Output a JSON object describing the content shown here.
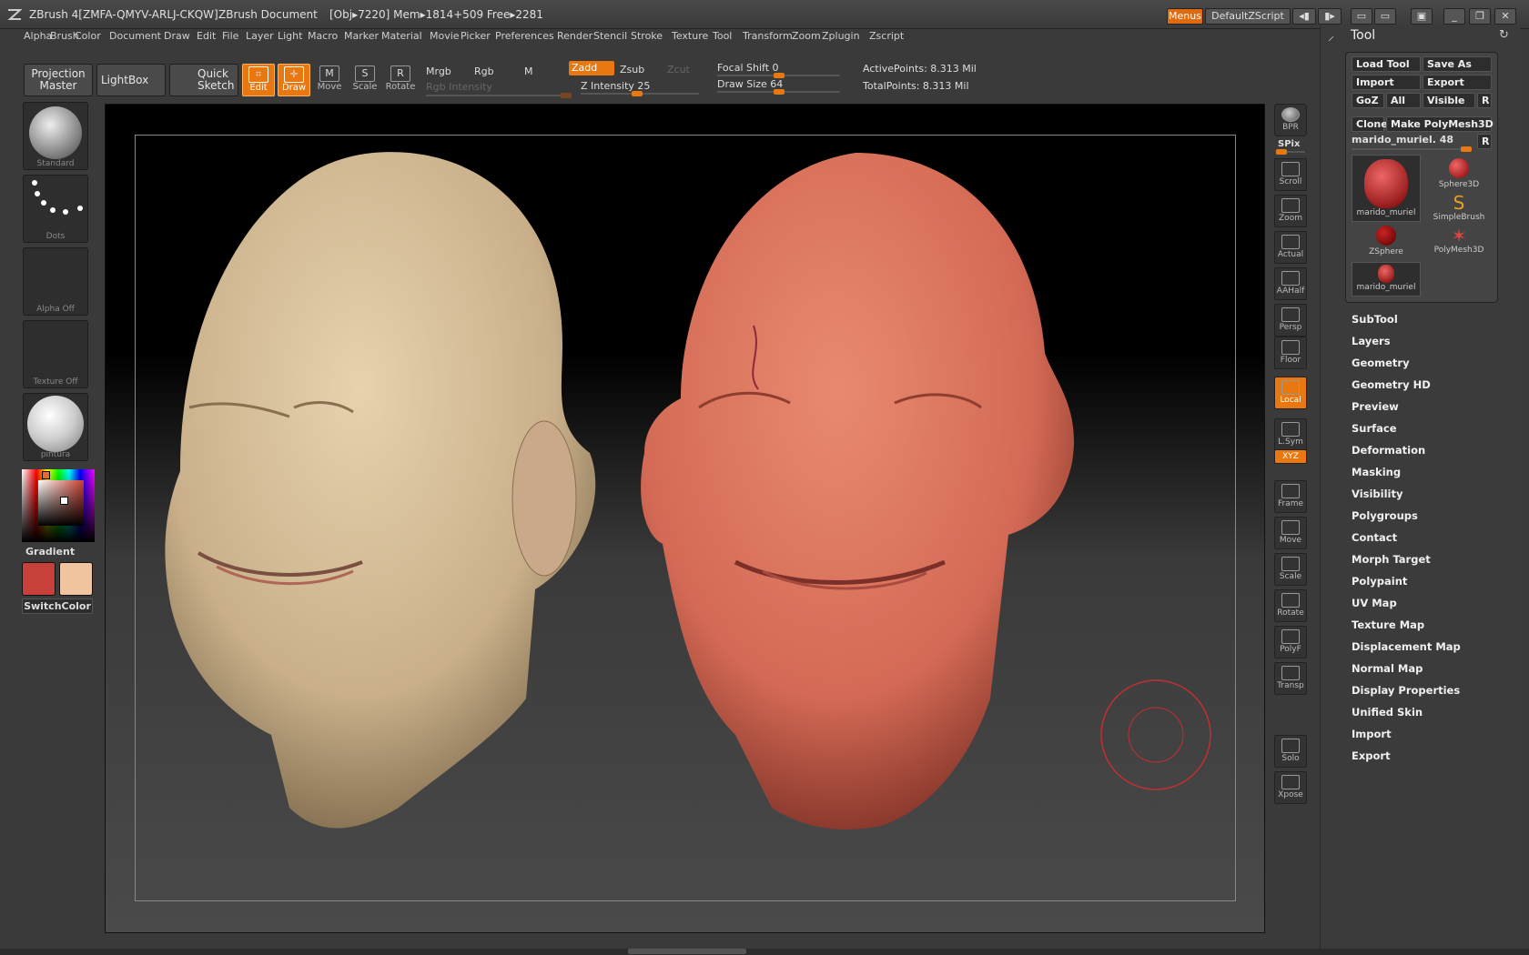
{
  "titlebar": {
    "app_title": "ZBrush 4[ZMFA-QMYV-ARLJ-CKQW]",
    "document": "ZBrush Document",
    "info": "[Obj▸7220] Mem▸1814+509 Free▸2281",
    "menus_button": "Menus",
    "script_button": "DefaultZScript"
  },
  "menubar": {
    "items": [
      "Alpha",
      "Brush",
      "Color",
      "Document",
      "Draw",
      "Edit",
      "File",
      "Layer",
      "Light",
      "Macro",
      "Marker",
      "Material",
      "Movie",
      "Picker",
      "Preferences",
      "Render",
      "Stencil",
      "Stroke",
      "Texture",
      "Tool",
      "Transform",
      "Zoom",
      "Zplugin",
      "Zscript"
    ]
  },
  "shelf": {
    "projection_master": "Projection Master",
    "lightbox": "LightBox",
    "quick_sketch": "Quick Sketch",
    "edit": "Edit",
    "draw": "Draw",
    "move": "Move",
    "scale": "Scale",
    "rotate": "Rotate",
    "mrgb": "Mrgb",
    "rgb": "Rgb",
    "m": "M",
    "zadd": "Zadd",
    "zsub": "Zsub",
    "zcut": "Zcut",
    "rgb_intensity": "Rgb Intensity",
    "z_intensity": "Z Intensity 25",
    "focal_shift": "Focal Shift 0",
    "draw_size": "Draw Size 64",
    "active_points": "ActivePoints: 8.313 Mil",
    "total_points": "TotalPoints: 8.313 Mil"
  },
  "left_shelf": {
    "brush": "Standard",
    "stroke": "Dots",
    "alpha": "Alpha  Off",
    "texture": "Texture  Off",
    "material": "pintura",
    "gradient": "Gradient",
    "switch_color": "SwitchColor",
    "main_color": "#c8403a",
    "secondary_color": "#f0c49e"
  },
  "right_shelf": {
    "bpr": "BPR",
    "spix": "SPix",
    "buttons": [
      "Scroll",
      "Zoom",
      "Actual",
      "AAHalf",
      "Persp",
      "Floor",
      "Local",
      "L.Sym",
      "XYZ",
      "Frame",
      "Move",
      "Scale",
      "Rotate",
      "PolyF",
      "Transp",
      "Solo",
      "Xpose"
    ]
  },
  "tool_palette": {
    "title": "Tool",
    "load_tool": "Load Tool",
    "save_as": "Save As",
    "import": "Import",
    "export": "Export",
    "goz": "GoZ",
    "all": "All",
    "visible": "Visible",
    "r": "R",
    "clone": "Clone",
    "make_polymesh": "Make PolyMesh3D",
    "current_tool": "marido_muriel. 48",
    "tools": [
      {
        "name": "marido_muriel"
      },
      {
        "name": "Sphere3D"
      },
      {
        "name": "SimpleBrush"
      },
      {
        "name": "ZSphere"
      },
      {
        "name": "PolyMesh3D"
      },
      {
        "name": "marido_muriel"
      }
    ],
    "subpalettes": [
      "SubTool",
      "Layers",
      "Geometry",
      "Geometry HD",
      "Preview",
      "Surface",
      "Deformation",
      "Masking",
      "Visibility",
      "Polygroups",
      "Contact",
      "Morph Target",
      "Polypaint",
      "UV Map",
      "Texture Map",
      "Displacement Map",
      "Normal Map",
      "Display Properties",
      "Unified Skin",
      "Import",
      "Export"
    ]
  }
}
